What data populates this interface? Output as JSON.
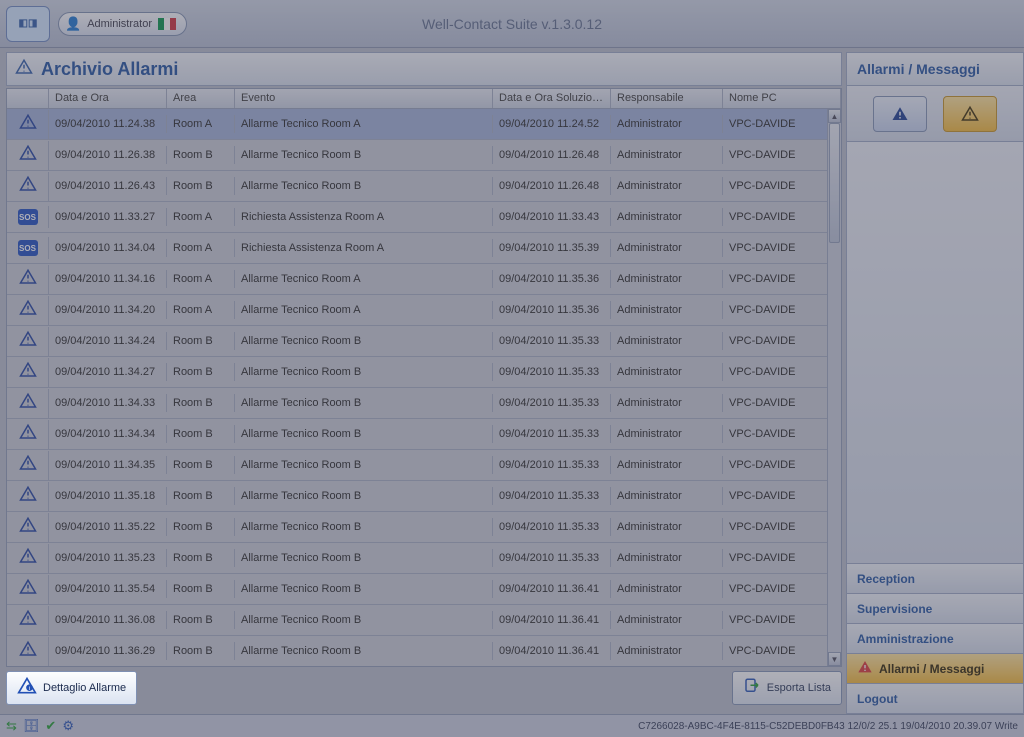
{
  "app_title": "Well-Contact Suite v.1.3.0.12",
  "user": "Administrator",
  "section_title": "Archivio Allarmi",
  "columns": {
    "c0": "",
    "c1": "Data e Ora",
    "c2": "Area",
    "c3": "Evento",
    "c4": "Data e Ora Soluzione",
    "c5": "Responsabile",
    "c6": "Nome PC"
  },
  "rows": [
    {
      "icon": "warn",
      "d": "09/04/2010 11.24.38",
      "a": "Room A",
      "e": "Allarme Tecnico Room A",
      "s": "09/04/2010 11.24.52",
      "r": "Administrator",
      "p": "VPC-DAVIDE",
      "sel": true
    },
    {
      "icon": "warn",
      "d": "09/04/2010 11.26.38",
      "a": "Room B",
      "e": "Allarme Tecnico Room B",
      "s": "09/04/2010 11.26.48",
      "r": "Administrator",
      "p": "VPC-DAVIDE"
    },
    {
      "icon": "warn",
      "d": "09/04/2010 11.26.43",
      "a": "Room B",
      "e": "Allarme Tecnico Room B",
      "s": "09/04/2010 11.26.48",
      "r": "Administrator",
      "p": "VPC-DAVIDE"
    },
    {
      "icon": "sos",
      "d": "09/04/2010 11.33.27",
      "a": "Room A",
      "e": "Richiesta Assistenza Room A",
      "s": "09/04/2010 11.33.43",
      "r": "Administrator",
      "p": "VPC-DAVIDE"
    },
    {
      "icon": "sos",
      "d": "09/04/2010 11.34.04",
      "a": "Room A",
      "e": "Richiesta Assistenza Room A",
      "s": "09/04/2010 11.35.39",
      "r": "Administrator",
      "p": "VPC-DAVIDE"
    },
    {
      "icon": "warn",
      "d": "09/04/2010 11.34.16",
      "a": "Room A",
      "e": "Allarme Tecnico Room A",
      "s": "09/04/2010 11.35.36",
      "r": "Administrator",
      "p": "VPC-DAVIDE"
    },
    {
      "icon": "warn",
      "d": "09/04/2010 11.34.20",
      "a": "Room A",
      "e": "Allarme Tecnico Room A",
      "s": "09/04/2010 11.35.36",
      "r": "Administrator",
      "p": "VPC-DAVIDE"
    },
    {
      "icon": "warn",
      "d": "09/04/2010 11.34.24",
      "a": "Room B",
      "e": "Allarme Tecnico Room B",
      "s": "09/04/2010 11.35.33",
      "r": "Administrator",
      "p": "VPC-DAVIDE"
    },
    {
      "icon": "warn",
      "d": "09/04/2010 11.34.27",
      "a": "Room B",
      "e": "Allarme Tecnico Room B",
      "s": "09/04/2010 11.35.33",
      "r": "Administrator",
      "p": "VPC-DAVIDE"
    },
    {
      "icon": "warn",
      "d": "09/04/2010 11.34.33",
      "a": "Room B",
      "e": "Allarme Tecnico Room B",
      "s": "09/04/2010 11.35.33",
      "r": "Administrator",
      "p": "VPC-DAVIDE"
    },
    {
      "icon": "warn",
      "d": "09/04/2010 11.34.34",
      "a": "Room B",
      "e": "Allarme Tecnico Room B",
      "s": "09/04/2010 11.35.33",
      "r": "Administrator",
      "p": "VPC-DAVIDE"
    },
    {
      "icon": "warn",
      "d": "09/04/2010 11.34.35",
      "a": "Room B",
      "e": "Allarme Tecnico Room B",
      "s": "09/04/2010 11.35.33",
      "r": "Administrator",
      "p": "VPC-DAVIDE"
    },
    {
      "icon": "warn",
      "d": "09/04/2010 11.35.18",
      "a": "Room B",
      "e": "Allarme Tecnico Room B",
      "s": "09/04/2010 11.35.33",
      "r": "Administrator",
      "p": "VPC-DAVIDE"
    },
    {
      "icon": "warn",
      "d": "09/04/2010 11.35.22",
      "a": "Room B",
      "e": "Allarme Tecnico Room B",
      "s": "09/04/2010 11.35.33",
      "r": "Administrator",
      "p": "VPC-DAVIDE"
    },
    {
      "icon": "warn",
      "d": "09/04/2010 11.35.23",
      "a": "Room B",
      "e": "Allarme Tecnico Room B",
      "s": "09/04/2010 11.35.33",
      "r": "Administrator",
      "p": "VPC-DAVIDE"
    },
    {
      "icon": "warn",
      "d": "09/04/2010 11.35.54",
      "a": "Room B",
      "e": "Allarme Tecnico Room B",
      "s": "09/04/2010 11.36.41",
      "r": "Administrator",
      "p": "VPC-DAVIDE"
    },
    {
      "icon": "warn",
      "d": "09/04/2010 11.36.08",
      "a": "Room B",
      "e": "Allarme Tecnico Room B",
      "s": "09/04/2010 11.36.41",
      "r": "Administrator",
      "p": "VPC-DAVIDE"
    },
    {
      "icon": "warn",
      "d": "09/04/2010 11.36.29",
      "a": "Room B",
      "e": "Allarme Tecnico Room B",
      "s": "09/04/2010 11.36.41",
      "r": "Administrator",
      "p": "VPC-DAVIDE"
    }
  ],
  "buttons": {
    "detail": "Dettaglio Allarme",
    "export": "Esporta Lista"
  },
  "sidebar": {
    "head": "Allarmi / Messaggi",
    "nav": {
      "reception": "Reception",
      "supervisione": "Supervisione",
      "amministrazione": "Amministrazione",
      "allarmi": "Allarmi / Messaggi",
      "logout": "Logout"
    }
  },
  "status": "C7266028-A9BC-4F4E-8115-C52DEBD0FB43 12/0/2 25.1 19/04/2010 20.39.07 Write"
}
